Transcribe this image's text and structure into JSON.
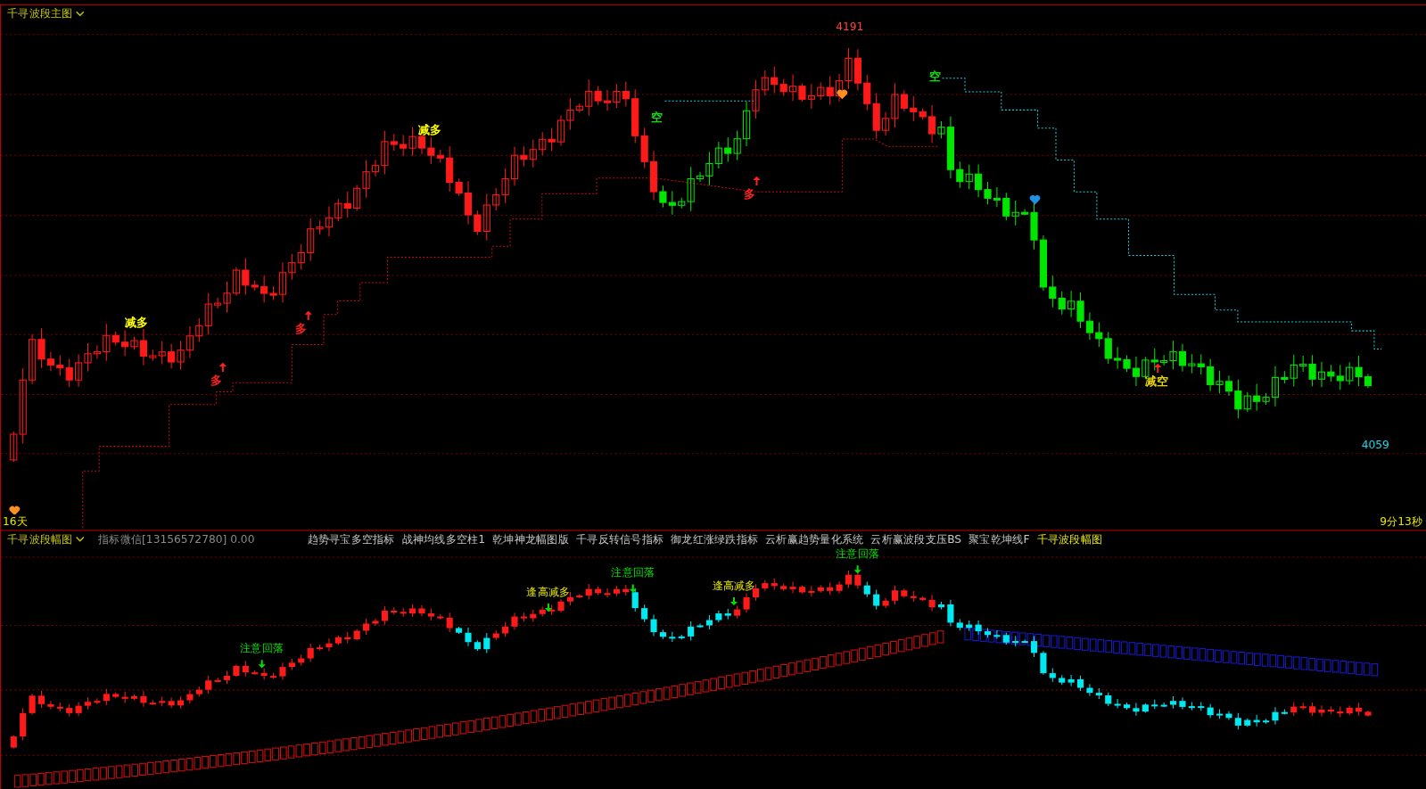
{
  "main_panel": {
    "title": "千寻波段主图",
    "high_label": "4191",
    "low_label": "4059",
    "days": "16天",
    "timer": "9分13秒",
    "signals": [
      {
        "kind": "reduce_long",
        "text": "减多"
      },
      {
        "kind": "reduce_long",
        "text": "减多"
      },
      {
        "kind": "short",
        "text": "空"
      },
      {
        "kind": "short",
        "text": "空"
      },
      {
        "kind": "long",
        "text": "多"
      },
      {
        "kind": "long",
        "text": "多"
      },
      {
        "kind": "long",
        "text": "多"
      },
      {
        "kind": "reduce_short",
        "text": "减空"
      }
    ]
  },
  "sub_panel": {
    "title": "千寻波段幅图",
    "info": "指标微信[13156572780] 0.00",
    "indicators": [
      {
        "label": "趋势寻宝多空指标",
        "selected": false
      },
      {
        "label": "战神均线多空柱1",
        "selected": false
      },
      {
        "label": "乾坤神龙幅图版",
        "selected": false
      },
      {
        "label": "千寻反转信号指标",
        "selected": false
      },
      {
        "label": "御龙红涨绿跌指标",
        "selected": false
      },
      {
        "label": "云析赢趋势量化系统",
        "selected": false
      },
      {
        "label": "云析赢波段支压BS",
        "selected": false
      },
      {
        "label": "聚宝乾坤线F",
        "selected": false
      },
      {
        "label": "千寻波段幅图",
        "selected": true
      }
    ],
    "signals": [
      {
        "kind": "caution",
        "text": "注意回落"
      },
      {
        "kind": "caution",
        "text": "注意回落"
      },
      {
        "kind": "caution",
        "text": "注意回落"
      },
      {
        "kind": "reduce",
        "text": "逢高减多"
      },
      {
        "kind": "reduce",
        "text": "逢高减多"
      }
    ]
  }
}
